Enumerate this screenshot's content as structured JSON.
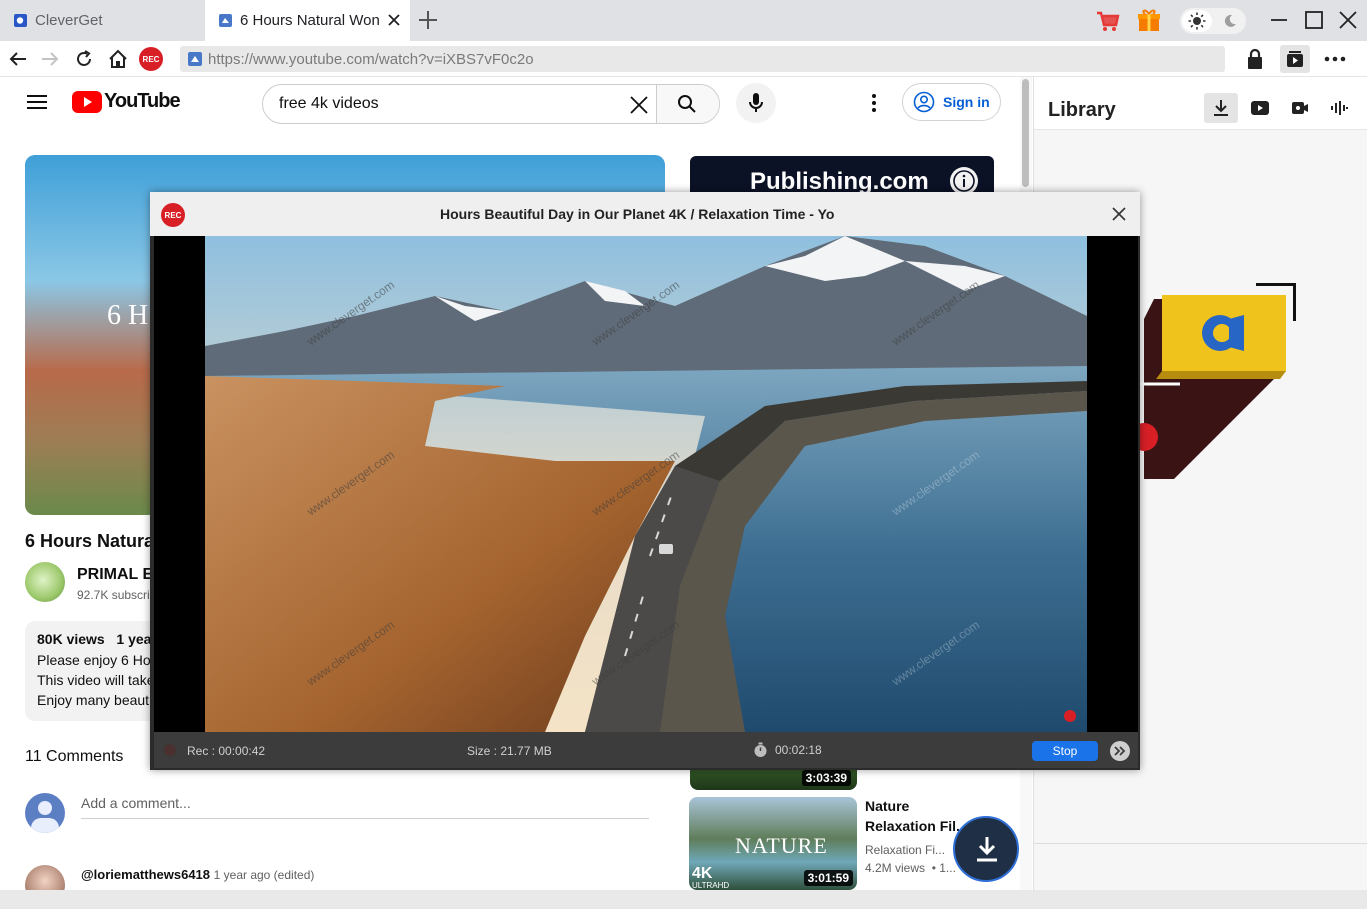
{
  "tabs": [
    {
      "label": "CleverGet",
      "active": false
    },
    {
      "label": "6 Hours Natural Won",
      "active": true
    }
  ],
  "address": {
    "url": "https://www.youtube.com/watch?v=iXBS7vF0c2o"
  },
  "youtube": {
    "logo_text": "YouTube",
    "search_query": "free 4k videos",
    "sign_in": "Sign in",
    "video_overlay_text": "6 H",
    "video_title": "6 Hours Natura",
    "channel_name": "PRIMAL E",
    "subscribers": "92.7K subscri",
    "desc": {
      "views": "80K views",
      "age": "1 year",
      "line1": "Please enjoy 6 Hou",
      "line2": "This video will take",
      "line3": "Enjoy many beauti"
    },
    "comments_count": "11 Comments",
    "add_comment_placeholder": "Add a comment...",
    "comment_user": "@loriematthews6418",
    "comment_meta": "1 year ago (edited)",
    "ad_text": "Publishing.com",
    "rec1": {
      "duration": "3:03:39"
    },
    "rec2": {
      "title_line1": "Nature",
      "title_line2": "Relaxation Fil...",
      "channel": "Relaxation Fi...",
      "views": "4.2M views",
      "extra": "• 1...",
      "duration": "3:01:59",
      "thumb_text": "NATURE",
      "badge": "4K",
      "badge_sub": "ULTRAHD"
    }
  },
  "library": {
    "title": "Library"
  },
  "recorder": {
    "badge": "REC",
    "title": "Hours Beautiful Day in Our Planet 4K / Relaxation Time - Yo",
    "watermark": "www.cleverget.com",
    "rec_time": "Rec : 00:00:42",
    "size": "Size : 21.77 MB",
    "duration": "00:02:18",
    "stop": "Stop"
  },
  "colors": {
    "accent_blue": "#1565c0",
    "rec_red": "#d81f26",
    "youtube_red": "#ff0000",
    "stop_blue": "#1a73e8"
  }
}
